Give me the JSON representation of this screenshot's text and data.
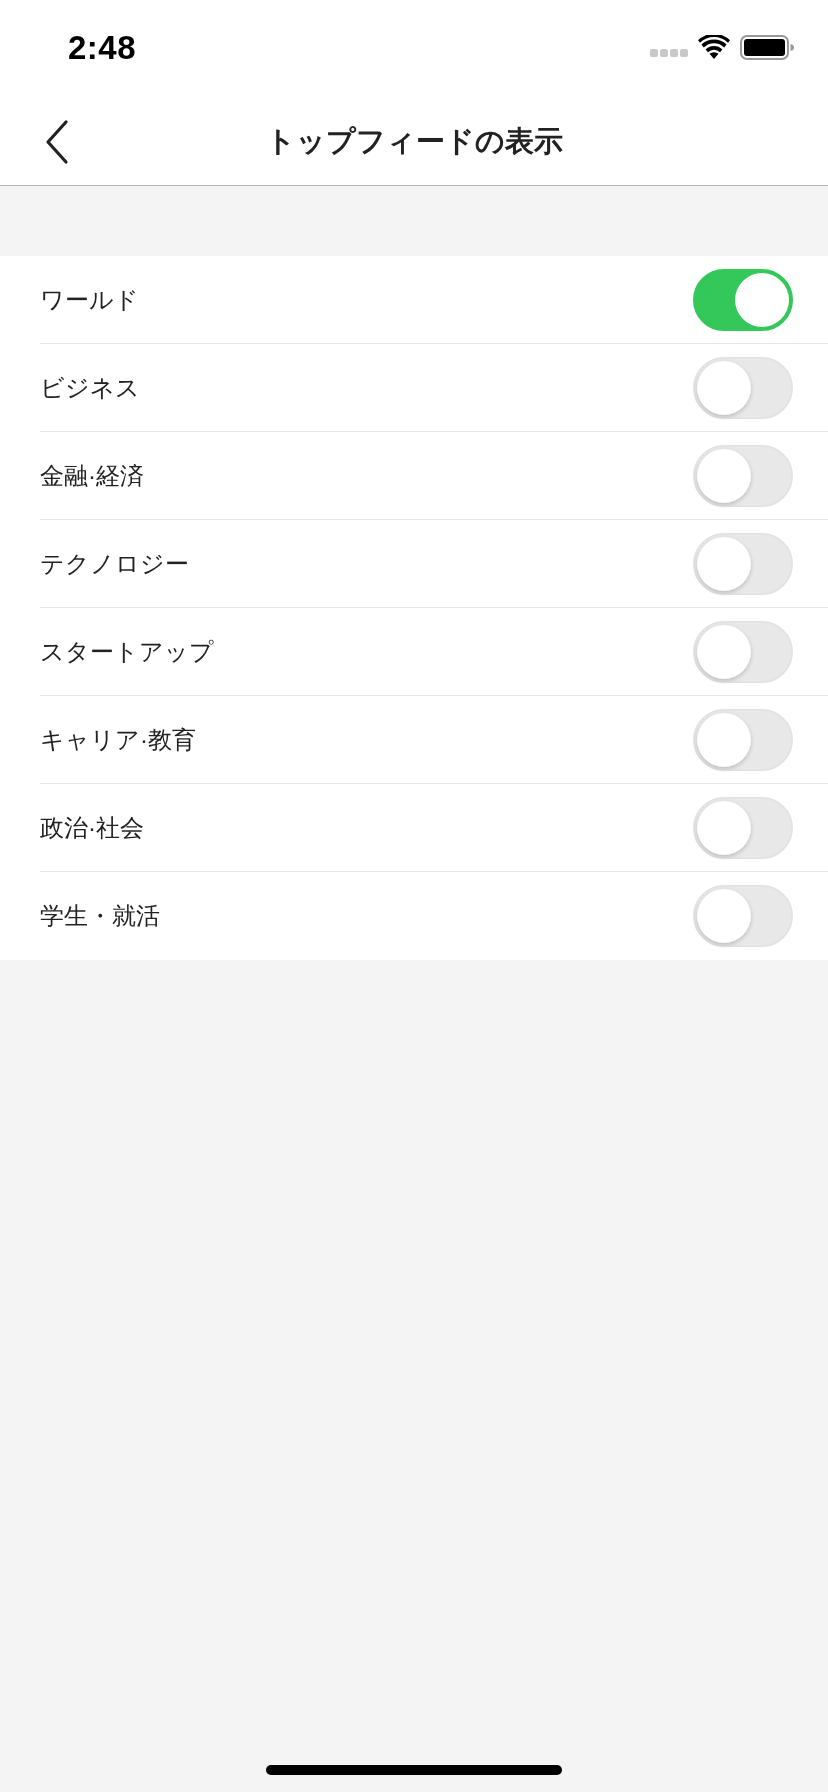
{
  "status_bar": {
    "time": "2:48"
  },
  "nav_bar": {
    "title": "トップフィードの表示"
  },
  "settings": [
    {
      "label": "ワールド",
      "on": true
    },
    {
      "label": "ビジネス",
      "on": false
    },
    {
      "label": "金融·経済",
      "on": false
    },
    {
      "label": "テクノロジー",
      "on": false
    },
    {
      "label": "スタートアップ",
      "on": false
    },
    {
      "label": "キャリア·教育",
      "on": false
    },
    {
      "label": "政治·社会",
      "on": false
    },
    {
      "label": "学生・就活",
      "on": false
    }
  ]
}
